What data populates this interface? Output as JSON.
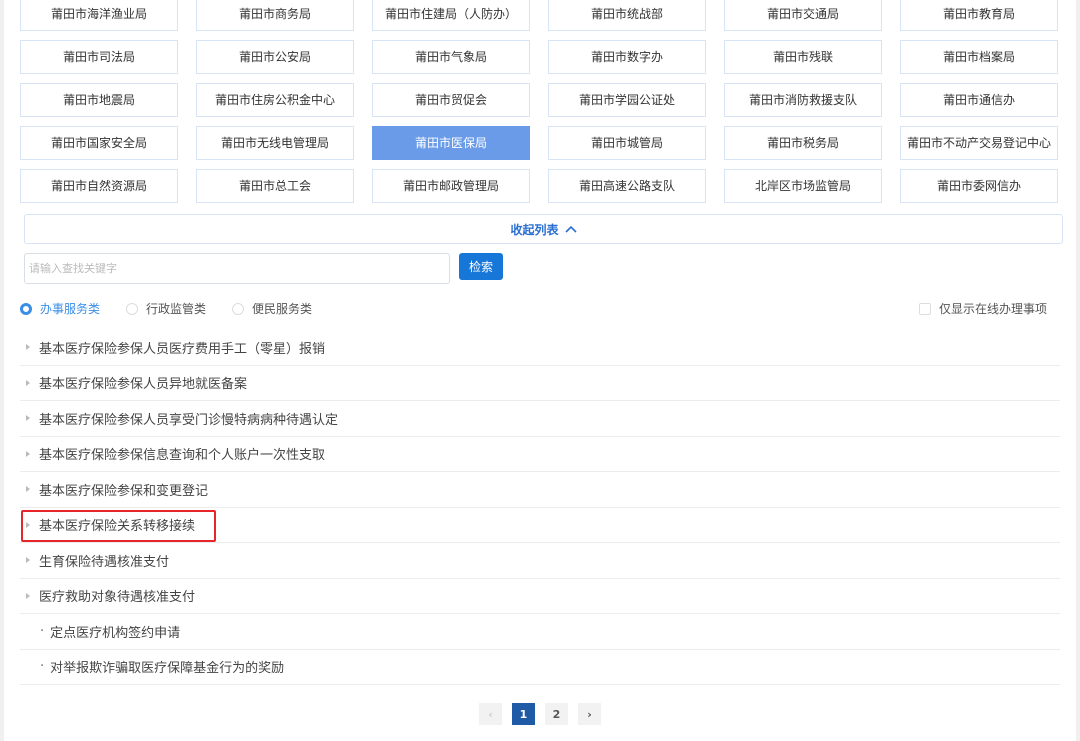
{
  "departments": [
    {
      "label": "莆田市海洋渔业局"
    },
    {
      "label": "莆田市商务局"
    },
    {
      "label": "莆田市住建局（人防办）"
    },
    {
      "label": "莆田市统战部"
    },
    {
      "label": "莆田市交通局"
    },
    {
      "label": "莆田市教育局"
    },
    {
      "label": "莆田市司法局"
    },
    {
      "label": "莆田市公安局"
    },
    {
      "label": "莆田市气象局"
    },
    {
      "label": "莆田市数字办"
    },
    {
      "label": "莆田市残联"
    },
    {
      "label": "莆田市档案局"
    },
    {
      "label": "莆田市地震局"
    },
    {
      "label": "莆田市住房公积金中心"
    },
    {
      "label": "莆田市贸促会"
    },
    {
      "label": "莆田市学园公证处"
    },
    {
      "label": "莆田市消防救援支队"
    },
    {
      "label": "莆田市通信办"
    },
    {
      "label": "莆田市国家安全局"
    },
    {
      "label": "莆田市无线电管理局"
    },
    {
      "label": "莆田市医保局",
      "active": true
    },
    {
      "label": "莆田市城管局"
    },
    {
      "label": "莆田市税务局"
    },
    {
      "label": "莆田市不动产交易登记中心"
    },
    {
      "label": "莆田市自然资源局"
    },
    {
      "label": "莆田市总工会"
    },
    {
      "label": "莆田市邮政管理局"
    },
    {
      "label": "莆田高速公路支队"
    },
    {
      "label": "北岸区市场监管局"
    },
    {
      "label": "莆田市委网信办"
    }
  ],
  "collapse_label": "收起列表",
  "search": {
    "placeholder": "请输入查找关键字",
    "button": "检索"
  },
  "categories": [
    {
      "label": "办事服务类",
      "selected": true
    },
    {
      "label": "行政监管类"
    },
    {
      "label": "便民服务类"
    }
  ],
  "online_only_label": "仅显示在线办理事项",
  "items": [
    {
      "label": "基本医疗保险参保人员医疗费用手工（零星）报销",
      "type": "expand"
    },
    {
      "label": "基本医疗保险参保人员异地就医备案",
      "type": "expand"
    },
    {
      "label": "基本医疗保险参保人员享受门诊慢特病病种待遇认定",
      "type": "expand"
    },
    {
      "label": "基本医疗保险参保信息查询和个人账户一次性支取",
      "type": "expand"
    },
    {
      "label": "基本医疗保险参保和变更登记",
      "type": "expand"
    },
    {
      "label": "基本医疗保险关系转移接续",
      "type": "expand",
      "highlighted": true
    },
    {
      "label": "生育保险待遇核准支付",
      "type": "expand"
    },
    {
      "label": "医疗救助对象待遇核准支付",
      "type": "expand"
    },
    {
      "label": "定点医疗机构签约申请",
      "type": "bullet"
    },
    {
      "label": "对举报欺诈骗取医疗保障基金行为的奖励",
      "type": "bullet"
    }
  ],
  "pagination": {
    "pages": [
      "1",
      "2"
    ],
    "current": "1"
  },
  "colors": {
    "accent": "#1677d9",
    "active_dept": "#6a9be8",
    "highlight": "#e8262a",
    "current_page": "#1f5aa6"
  }
}
